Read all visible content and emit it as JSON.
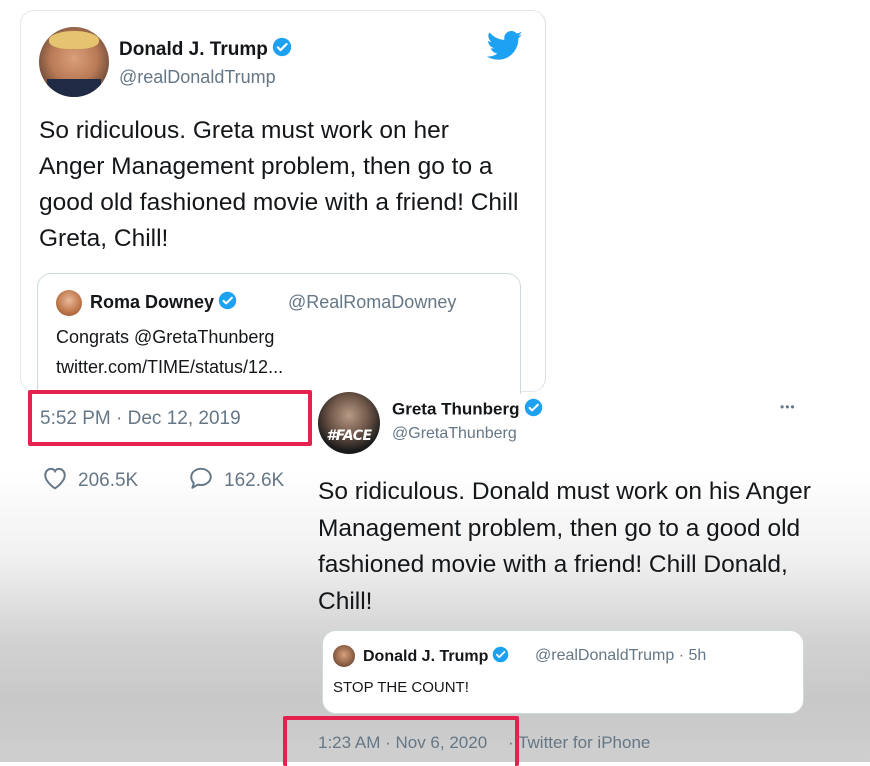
{
  "tweet1": {
    "author_name": "Donald J. Trump",
    "author_handle": "@realDonaldTrump",
    "text": "So ridiculous. Greta must work on her Anger Management problem, then go to a good old fashioned movie with a friend! Chill Greta, Chill!",
    "quoted": {
      "author_name": "Roma Downey",
      "author_handle": "@RealRomaDowney",
      "line1": "Congrats @GretaThunberg",
      "line2": "twitter.com/TIME/status/12..."
    },
    "timestamp": "5:52 PM · Dec 12, 2019",
    "likes": "206.5K",
    "replies": "162.6K",
    "brand_color": "#1da1f2",
    "highlight_color": "#e5224e"
  },
  "tweet2": {
    "author_name": "Greta Thunberg",
    "author_handle": "@GretaThunberg",
    "avatar_text": "#FACE",
    "more_label": "•••",
    "text": "So ridiculous. Donald must work on his Anger Management problem, then go to a good old fashioned movie with a friend! Chill Donald, Chill!",
    "quoted": {
      "author_name": "Donald J. Trump",
      "author_handle": "@realDonaldTrump",
      "age": "· 5h",
      "text": "STOP THE COUNT!"
    },
    "timestamp": "1:23 AM · Nov 6, 2020",
    "source": "· Twitter for iPhone"
  },
  "icons": {
    "brand": "twitter-bird-icon",
    "verified": "verified-badge-icon",
    "like": "heart-icon",
    "reply": "comment-icon",
    "more": "more-options-icon"
  }
}
